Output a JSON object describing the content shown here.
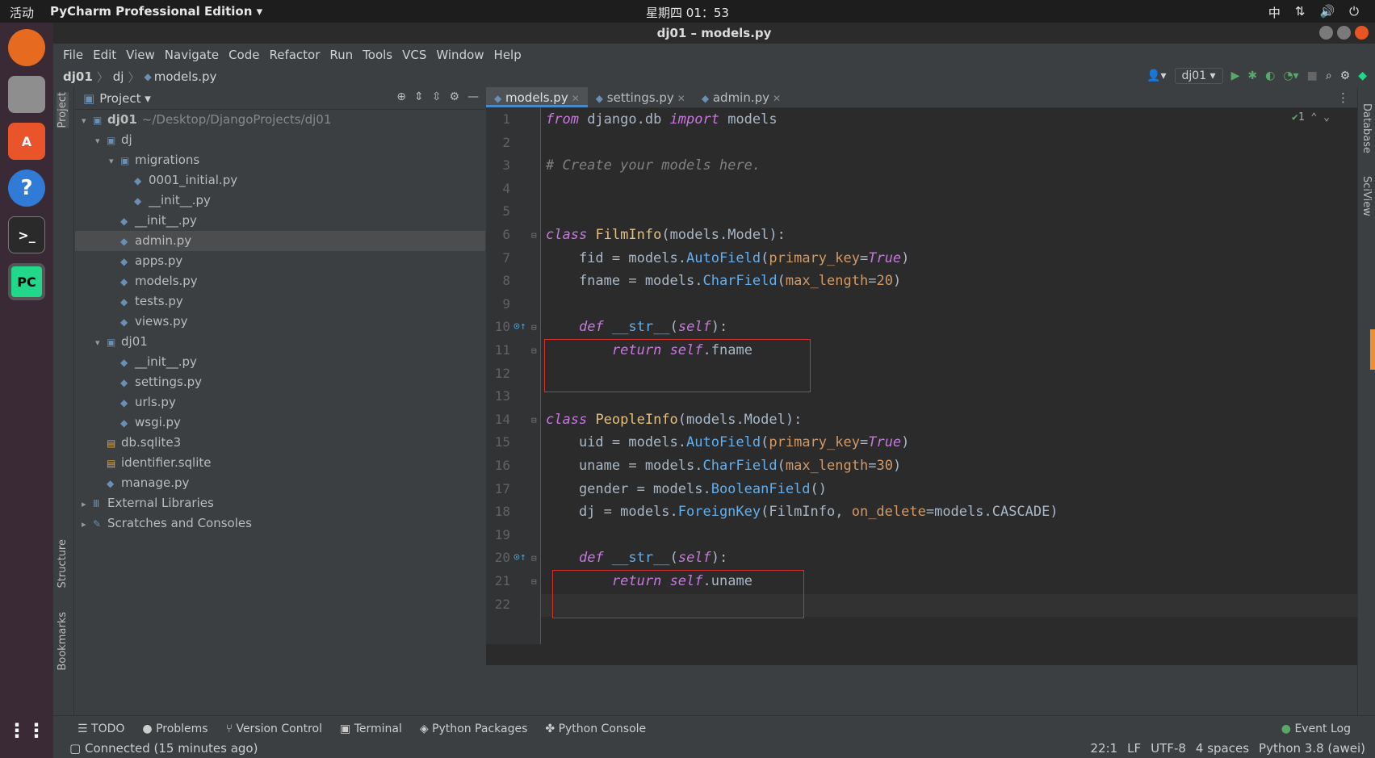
{
  "topbar": {
    "activities": "活动",
    "app_name": "PyCharm Professional Edition",
    "clock": "星期四 01：53",
    "input_method": "中"
  },
  "window": {
    "title": "dj01 – models.py"
  },
  "menu": [
    "File",
    "Edit",
    "View",
    "Navigate",
    "Code",
    "Refactor",
    "Run",
    "Tools",
    "VCS",
    "Window",
    "Help"
  ],
  "breadcrumb": {
    "project": "dj01",
    "folder": "dj",
    "file": "models.py"
  },
  "toolbar": {
    "run_config": "dj01"
  },
  "left_strip": {
    "project": "Project",
    "structure": "Structure",
    "bookmarks": "Bookmarks"
  },
  "right_strip": {
    "database": "Database",
    "sciview": "SciView"
  },
  "project_panel": {
    "title": "Project",
    "tree": [
      {
        "label": "dj01",
        "extra": "~/Desktop/DjangoProjects/dj01",
        "depth": 0,
        "arrow": "▾",
        "icon": "folder-icon"
      },
      {
        "label": "dj",
        "depth": 1,
        "arrow": "▾",
        "icon": "folder-icon"
      },
      {
        "label": "migrations",
        "depth": 2,
        "arrow": "▾",
        "icon": "folder-icon"
      },
      {
        "label": "0001_initial.py",
        "depth": 3,
        "arrow": "",
        "icon": "python-file-icon"
      },
      {
        "label": "__init__.py",
        "depth": 3,
        "arrow": "",
        "icon": "python-file-icon"
      },
      {
        "label": "__init__.py",
        "depth": 2,
        "arrow": "",
        "icon": "python-file-icon"
      },
      {
        "label": "admin.py",
        "depth": 2,
        "arrow": "",
        "icon": "python-file-icon",
        "selected": true
      },
      {
        "label": "apps.py",
        "depth": 2,
        "arrow": "",
        "icon": "python-file-icon"
      },
      {
        "label": "models.py",
        "depth": 2,
        "arrow": "",
        "icon": "python-file-icon"
      },
      {
        "label": "tests.py",
        "depth": 2,
        "arrow": "",
        "icon": "python-file-icon"
      },
      {
        "label": "views.py",
        "depth": 2,
        "arrow": "",
        "icon": "python-file-icon"
      },
      {
        "label": "dj01",
        "depth": 1,
        "arrow": "▾",
        "icon": "folder-icon"
      },
      {
        "label": "__init__.py",
        "depth": 2,
        "arrow": "",
        "icon": "python-file-icon"
      },
      {
        "label": "settings.py",
        "depth": 2,
        "arrow": "",
        "icon": "python-file-icon"
      },
      {
        "label": "urls.py",
        "depth": 2,
        "arrow": "",
        "icon": "python-file-icon"
      },
      {
        "label": "wsgi.py",
        "depth": 2,
        "arrow": "",
        "icon": "python-file-icon"
      },
      {
        "label": "db.sqlite3",
        "depth": 1,
        "arrow": "",
        "icon": "database-file-icon"
      },
      {
        "label": "identifier.sqlite",
        "depth": 1,
        "arrow": "",
        "icon": "database-file-icon"
      },
      {
        "label": "manage.py",
        "depth": 1,
        "arrow": "",
        "icon": "python-file-icon"
      },
      {
        "label": "External Libraries",
        "depth": 0,
        "arrow": "▸",
        "icon": "library-icon"
      },
      {
        "label": "Scratches and Consoles",
        "depth": 0,
        "arrow": "▸",
        "icon": "scratches-icon"
      }
    ]
  },
  "tabs": [
    {
      "label": "models.py",
      "active": true
    },
    {
      "label": "settings.py",
      "active": false
    },
    {
      "label": "admin.py",
      "active": false
    }
  ],
  "editor": {
    "inspection": "1",
    "lines": [
      [
        {
          "t": "from",
          "c": "kwp"
        },
        {
          "t": " django.db "
        },
        {
          "t": "import",
          "c": "kwp"
        },
        {
          "t": " models"
        }
      ],
      [],
      [
        {
          "t": "# Create your models here.",
          "c": "cm"
        }
      ],
      [],
      [],
      [
        {
          "t": "class",
          "c": "kwp"
        },
        {
          "t": " "
        },
        {
          "t": "FilmInfo",
          "c": "cls"
        },
        {
          "t": "(models.Model):"
        }
      ],
      [
        {
          "t": "    fid = models."
        },
        {
          "t": "AutoField",
          "c": "fn"
        },
        {
          "t": "("
        },
        {
          "t": "primary_key",
          "c": "prm"
        },
        {
          "t": "="
        },
        {
          "t": "True",
          "c": "tr"
        },
        {
          "t": ")"
        }
      ],
      [
        {
          "t": "    fname = models."
        },
        {
          "t": "CharField",
          "c": "fn"
        },
        {
          "t": "("
        },
        {
          "t": "max_length",
          "c": "prm"
        },
        {
          "t": "="
        },
        {
          "t": "20",
          "c": "num"
        },
        {
          "t": ")"
        }
      ],
      [],
      [
        {
          "t": "    "
        },
        {
          "t": "def",
          "c": "kwp"
        },
        {
          "t": " "
        },
        {
          "t": "__str__",
          "c": "fn"
        },
        {
          "t": "("
        },
        {
          "t": "self",
          "c": "slf"
        },
        {
          "t": "):"
        }
      ],
      [
        {
          "t": "        "
        },
        {
          "t": "return",
          "c": "kwp"
        },
        {
          "t": " "
        },
        {
          "t": "self",
          "c": "slf"
        },
        {
          "t": ".fname"
        }
      ],
      [],
      [],
      [
        {
          "t": "class",
          "c": "kwp"
        },
        {
          "t": " "
        },
        {
          "t": "PeopleInfo",
          "c": "cls"
        },
        {
          "t": "(models.Model):"
        }
      ],
      [
        {
          "t": "    uid = models."
        },
        {
          "t": "AutoField",
          "c": "fn"
        },
        {
          "t": "("
        },
        {
          "t": "primary_key",
          "c": "prm"
        },
        {
          "t": "="
        },
        {
          "t": "True",
          "c": "tr"
        },
        {
          "t": ")"
        }
      ],
      [
        {
          "t": "    uname = models."
        },
        {
          "t": "CharField",
          "c": "fn"
        },
        {
          "t": "("
        },
        {
          "t": "max_length",
          "c": "prm"
        },
        {
          "t": "="
        },
        {
          "t": "30",
          "c": "num"
        },
        {
          "t": ")"
        }
      ],
      [
        {
          "t": "    gender = models."
        },
        {
          "t": "BooleanField",
          "c": "fn"
        },
        {
          "t": "()"
        }
      ],
      [
        {
          "t": "    dj = models."
        },
        {
          "t": "ForeignKey",
          "c": "fn"
        },
        {
          "t": "(FilmInfo, "
        },
        {
          "t": "on_delete",
          "c": "prm"
        },
        {
          "t": "=models.CASCADE)"
        }
      ],
      [],
      [
        {
          "t": "    "
        },
        {
          "t": "def",
          "c": "kwp"
        },
        {
          "t": " "
        },
        {
          "t": "__str__",
          "c": "fn"
        },
        {
          "t": "("
        },
        {
          "t": "self",
          "c": "slf"
        },
        {
          "t": "):"
        }
      ],
      [
        {
          "t": "        "
        },
        {
          "t": "return",
          "c": "kwp"
        },
        {
          "t": " "
        },
        {
          "t": "self",
          "c": "slf"
        },
        {
          "t": ".uname"
        }
      ],
      []
    ]
  },
  "bottom_tools": [
    "TODO",
    "Problems",
    "Version Control",
    "Terminal",
    "Python Packages",
    "Python Console"
  ],
  "event_log": "Event Log",
  "status": {
    "left": "Connected (15 minutes ago)",
    "position": "22:1",
    "line_sep": "LF",
    "encoding": "UTF-8",
    "indent": "4 spaces",
    "interpreter": "Python 3.8 (awei)"
  }
}
